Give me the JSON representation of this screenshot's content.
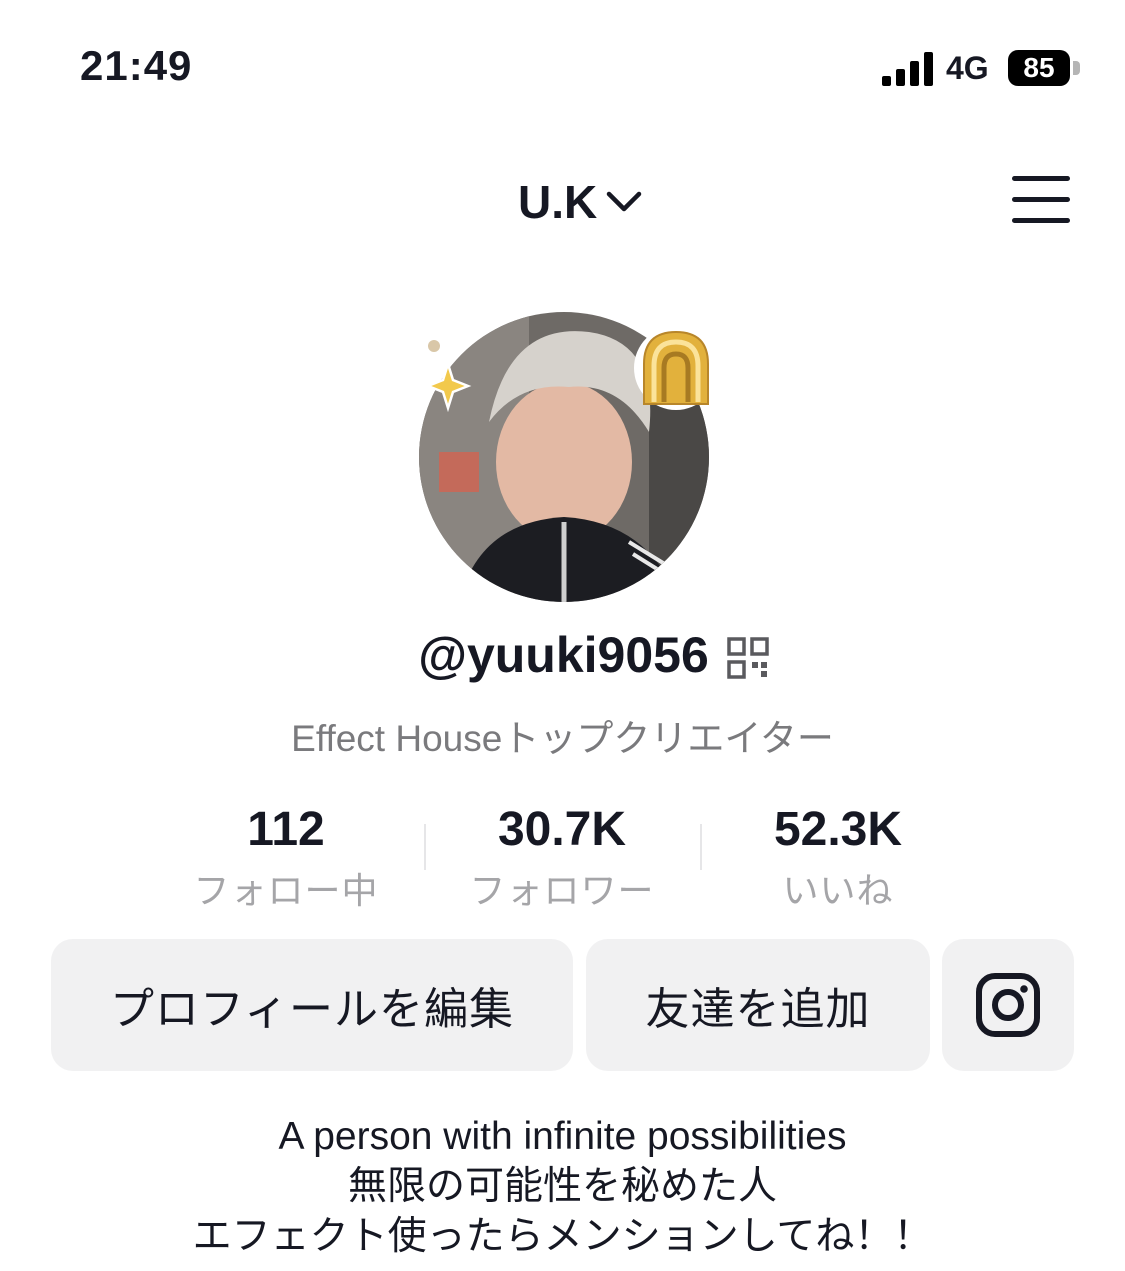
{
  "status_bar": {
    "time": "21:49",
    "network": "4G",
    "battery": "85"
  },
  "header": {
    "account_name": "U.K",
    "chevron_icon": "chevron-down-icon",
    "menu_icon": "hamburger-menu-icon"
  },
  "profile": {
    "username": "@yuuki9056",
    "subtitle": "Effect Houseトップクリエイター"
  },
  "stats": [
    {
      "value": "112",
      "label": "フォロー中"
    },
    {
      "value": "30.7K",
      "label": "フォロワー"
    },
    {
      "value": "52.3K",
      "label": "いいね"
    }
  ],
  "buttons": {
    "edit_profile": "プロフィールを編集",
    "add_friend": "友達を追加",
    "instagram_icon": "instagram-icon"
  },
  "bio": [
    "A person with infinite possibilities",
    "無限の可能性を秘めた人",
    "エフェクト使ったらメンションしてね！！"
  ],
  "colors": {
    "text": "#161823",
    "muted": "#a5a5a8",
    "button_bg": "#f1f1f2",
    "badge_gold": "#e2b13c"
  }
}
